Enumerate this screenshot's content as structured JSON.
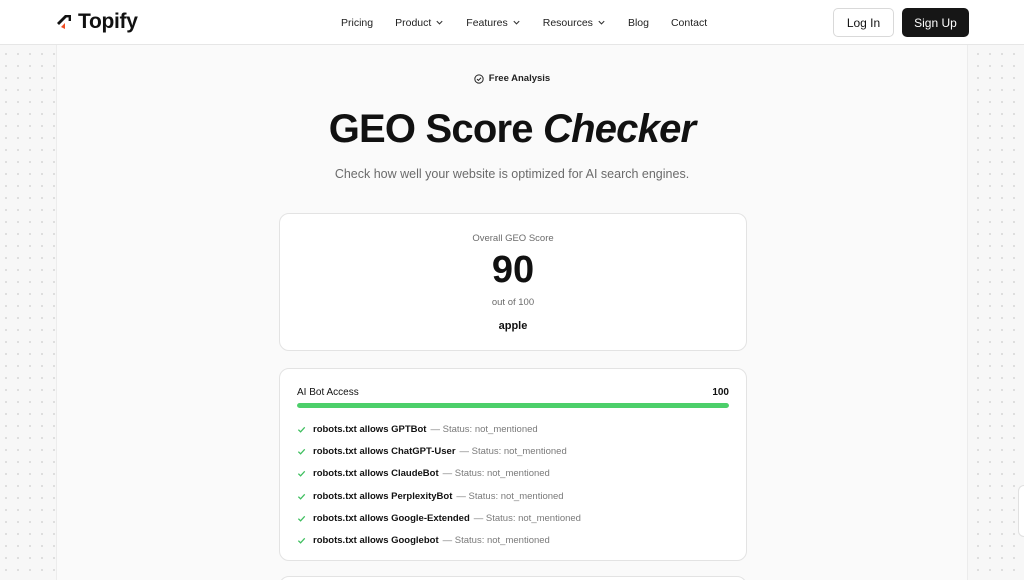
{
  "brand": {
    "name": "Topify"
  },
  "nav": {
    "items": [
      {
        "label": "Pricing",
        "dropdown": false
      },
      {
        "label": "Product",
        "dropdown": true
      },
      {
        "label": "Features",
        "dropdown": true
      },
      {
        "label": "Resources",
        "dropdown": true
      },
      {
        "label": "Blog",
        "dropdown": false
      },
      {
        "label": "Contact",
        "dropdown": false
      }
    ],
    "login_label": "Log In",
    "signup_label": "Sign Up"
  },
  "hero": {
    "badge": "Free Analysis",
    "title_main": "GEO Score",
    "title_italic": "Checker",
    "subtitle": "Check how well your website is optimized for AI search engines."
  },
  "score": {
    "label": "Overall GEO Score",
    "value": "90",
    "out_of": "out of 100",
    "site": "apple"
  },
  "bot_access": {
    "title": "AI Bot Access",
    "value": "100",
    "progress_percent": 100,
    "checks": [
      {
        "name": "robots.txt allows GPTBot",
        "status": "— Status: not_mentioned"
      },
      {
        "name": "robots.txt allows ChatGPT-User",
        "status": "— Status: not_mentioned"
      },
      {
        "name": "robots.txt allows ClaudeBot",
        "status": "— Status: not_mentioned"
      },
      {
        "name": "robots.txt allows PerplexityBot",
        "status": "— Status: not_mentioned"
      },
      {
        "name": "robots.txt allows Google-Extended",
        "status": "— Status: not_mentioned"
      },
      {
        "name": "robots.txt allows Googlebot",
        "status": "— Status: not_mentioned"
      }
    ]
  },
  "colors": {
    "accent_dark": "#161616",
    "progress_green": "#4ccf6a",
    "check_green": "#3fbf5f",
    "logo_orange": "#f04e23"
  }
}
